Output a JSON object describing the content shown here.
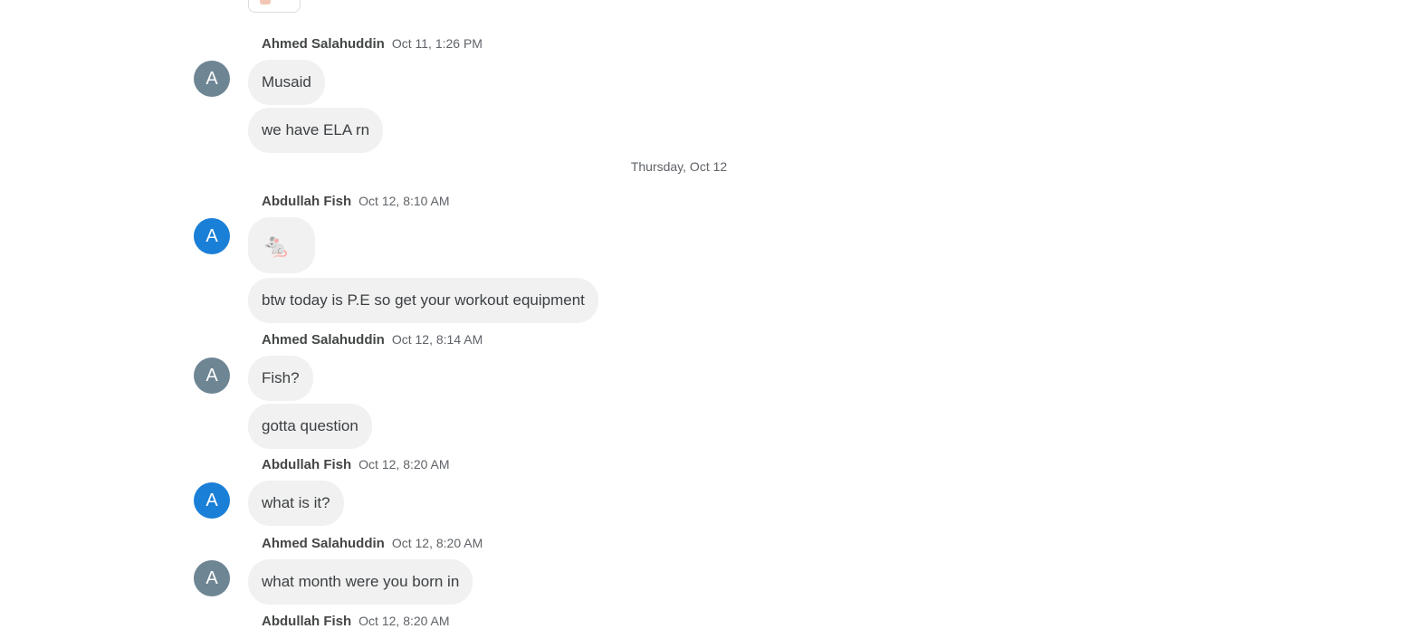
{
  "date_separator": "Thursday, Oct 12",
  "messages": [
    {
      "avatar_letter": "A",
      "author": "Ahmed Salahuddin",
      "time": "Oct 11, 1:26 PM",
      "bubbles": [
        "Musaid",
        "we have ELA rn"
      ]
    },
    {
      "avatar_letter": "A",
      "author": "Abdullah Fish",
      "time": "Oct 12, 8:10 AM",
      "bubbles": [
        "🐁",
        "btw today is P.E so get your workout equipment"
      ]
    },
    {
      "avatar_letter": "A",
      "author": "Ahmed Salahuddin",
      "time": "Oct 12, 8:14 AM",
      "bubbles": [
        "Fish?",
        "gotta question"
      ]
    },
    {
      "avatar_letter": "A",
      "author": "Abdullah Fish",
      "time": "Oct 12, 8:20 AM",
      "bubbles": [
        "what is it?"
      ]
    },
    {
      "avatar_letter": "A",
      "author": "Ahmed Salahuddin",
      "time": "Oct 12, 8:20 AM",
      "bubbles": [
        "what month were you born in"
      ]
    },
    {
      "author": "Abdullah Fish",
      "time": "Oct 12, 8:20 AM"
    }
  ],
  "colors": {
    "avatar_gray": "#6e8594",
    "avatar_blue": "#1a7fd6",
    "bubble_bg": "#f1f1f1"
  }
}
